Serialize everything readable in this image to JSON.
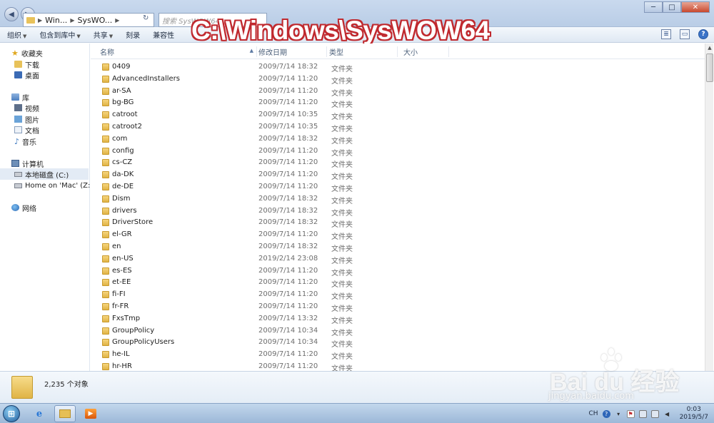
{
  "overlay_title": "C:\\Windows\\SysWOW64",
  "address_bar": {
    "segments": [
      "Win...",
      "SysWO..."
    ],
    "search_placeholder": "搜索 SysWOW64"
  },
  "toolbar": {
    "items": [
      "组织",
      "包含到库中",
      "共享",
      "刻录",
      "兼容性"
    ],
    "help_label": "?"
  },
  "window_controls": {
    "minimize": "─",
    "maximize": "□",
    "close": "✕"
  },
  "nav": {
    "favorites_label": "收藏夹",
    "downloads_label": "下载",
    "desktop_label": "桌面",
    "libraries_label": "库",
    "videos_label": "视频",
    "pictures_label": "图片",
    "documents_label": "文档",
    "music_label": "音乐",
    "computer_label": "计算机",
    "local_disk_label": "本地磁盘 (C:)",
    "mac_drive_label": "Home on 'Mac' (Z:)",
    "network_label": "网络"
  },
  "columns": {
    "name": "名称",
    "date": "修改日期",
    "type": "类型",
    "size": "大小"
  },
  "files": [
    {
      "name": "0409",
      "date": "2009/7/14 18:32",
      "type": "文件夹"
    },
    {
      "name": "AdvancedInstallers",
      "date": "2009/7/14 11:20",
      "type": "文件夹"
    },
    {
      "name": "ar-SA",
      "date": "2009/7/14 11:20",
      "type": "文件夹"
    },
    {
      "name": "bg-BG",
      "date": "2009/7/14 11:20",
      "type": "文件夹"
    },
    {
      "name": "catroot",
      "date": "2009/7/14 10:35",
      "type": "文件夹"
    },
    {
      "name": "catroot2",
      "date": "2009/7/14 10:35",
      "type": "文件夹"
    },
    {
      "name": "com",
      "date": "2009/7/14 18:32",
      "type": "文件夹"
    },
    {
      "name": "config",
      "date": "2009/7/14 11:20",
      "type": "文件夹"
    },
    {
      "name": "cs-CZ",
      "date": "2009/7/14 11:20",
      "type": "文件夹"
    },
    {
      "name": "da-DK",
      "date": "2009/7/14 11:20",
      "type": "文件夹"
    },
    {
      "name": "de-DE",
      "date": "2009/7/14 11:20",
      "type": "文件夹"
    },
    {
      "name": "Dism",
      "date": "2009/7/14 18:32",
      "type": "文件夹"
    },
    {
      "name": "drivers",
      "date": "2009/7/14 18:32",
      "type": "文件夹"
    },
    {
      "name": "DriverStore",
      "date": "2009/7/14 18:32",
      "type": "文件夹"
    },
    {
      "name": "el-GR",
      "date": "2009/7/14 11:20",
      "type": "文件夹"
    },
    {
      "name": "en",
      "date": "2009/7/14 18:32",
      "type": "文件夹"
    },
    {
      "name": "en-US",
      "date": "2019/2/14 23:08",
      "type": "文件夹"
    },
    {
      "name": "es-ES",
      "date": "2009/7/14 11:20",
      "type": "文件夹"
    },
    {
      "name": "et-EE",
      "date": "2009/7/14 11:20",
      "type": "文件夹"
    },
    {
      "name": "fi-FI",
      "date": "2009/7/14 11:20",
      "type": "文件夹"
    },
    {
      "name": "fr-FR",
      "date": "2009/7/14 11:20",
      "type": "文件夹"
    },
    {
      "name": "FxsTmp",
      "date": "2009/7/14 13:32",
      "type": "文件夹"
    },
    {
      "name": "GroupPolicy",
      "date": "2009/7/14 10:34",
      "type": "文件夹"
    },
    {
      "name": "GroupPolicyUsers",
      "date": "2009/7/14 10:34",
      "type": "文件夹"
    },
    {
      "name": "he-IL",
      "date": "2009/7/14 11:20",
      "type": "文件夹"
    },
    {
      "name": "hr-HR",
      "date": "2009/7/14 11:20",
      "type": "文件夹"
    }
  ],
  "details": {
    "count": "2,235 个对象"
  },
  "taskbar": {
    "start_label": "⊞",
    "tray_lang": "CH",
    "clock_time": "0:03",
    "clock_date": "2019/5/7"
  },
  "watermark": {
    "main": "Bai du 经验",
    "sub": "jingyan.baidu.com"
  }
}
